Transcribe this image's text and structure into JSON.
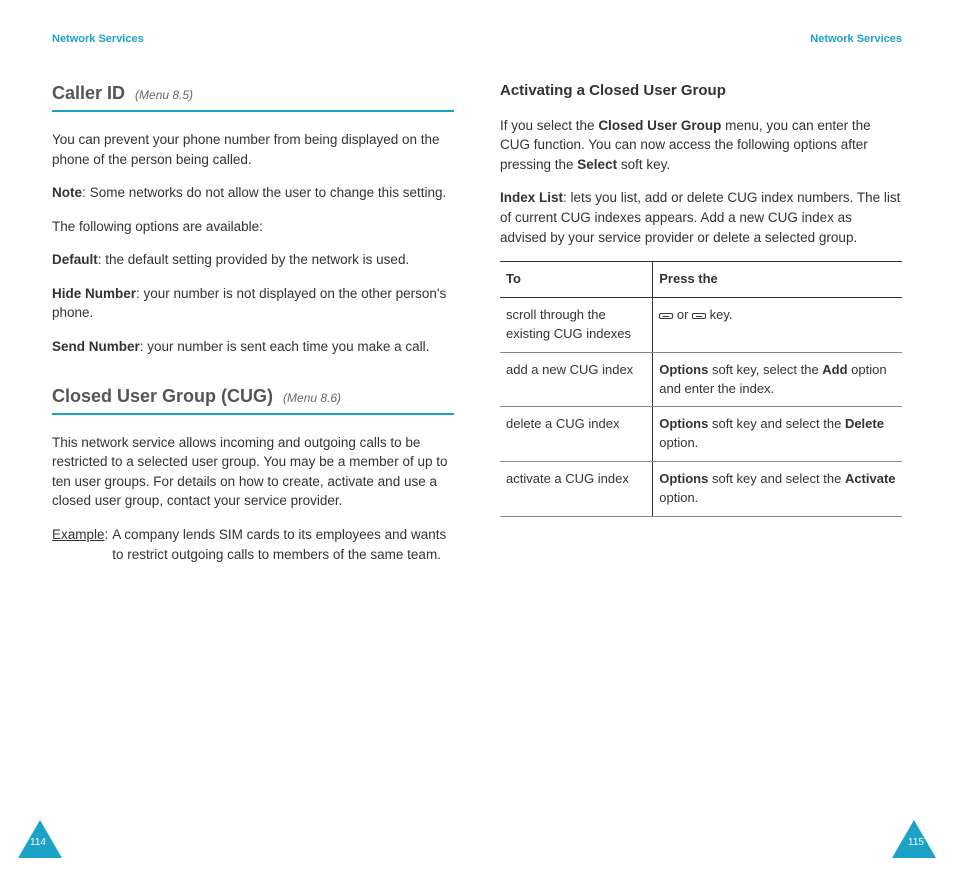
{
  "header": {
    "left": "Network Services",
    "right": "Network Services"
  },
  "left": {
    "s1_title": "Caller ID",
    "s1_menu": "(Menu 8.5)",
    "s1_p1": "You can prevent your phone number from being displayed on the phone of the person being called.",
    "s1_note_label": "Note",
    "s1_note_text": "Some networks do not allow the user to change this setting.",
    "s1_p2": "The following options are available:",
    "s1_o1_l": "Default",
    "s1_o1_t": ": the default setting provided by the network is used.",
    "s1_o2_l": "Hide Number",
    "s1_o2_t": ": your number is not displayed on the other person's phone.",
    "s1_o3_l": "Send Number",
    "s1_o3_t": ": your number is sent each time you make a call.",
    "s2_title": "Closed User Group (CUG)",
    "s2_menu": "(Menu 8.6)",
    "s2_p1": "This network service allows incoming and outgoing calls to be restricted to a selected user group. You may be a member of up to ten user groups. For details on how to create, activate and use a closed user group, contact your service provider.",
    "s2_ex_label": "Example",
    "s2_ex_text": "A company lends SIM cards to its employees and wants to restrict outgoing calls to members of the same team."
  },
  "right": {
    "sub": "Activating a Closed User Group",
    "p1a": "If you select the ",
    "p1b": "Closed User Group",
    "p1c": " menu, you can enter the CUG function. You can now access the following options after pressing the ",
    "p1d": "Select",
    "p1e": " soft key.",
    "p2a": "Index List",
    "p2b": ": lets you list, add or delete CUG index numbers. The list of current CUG indexes appears. Add a new CUG index as advised by your service provider or delete a selected group.",
    "th1": "To",
    "th2": "Press the",
    "r1c1": "scroll through the existing CUG indexes",
    "r1_mid": " or ",
    "r1_end": " key.",
    "r2c1": "add a new CUG index",
    "r2a": "Options",
    "r2b": " soft key, select the ",
    "r2c": "Add",
    "r2d": " option and enter the index.",
    "r3c1": "delete a CUG index",
    "r3a": "Options",
    "r3b": " soft key and select the ",
    "r3c": "Delete",
    "r3d": " option.",
    "r4c1": "activate a CUG index",
    "r4a": "Options",
    "r4b": " soft key and select the ",
    "r4c": "Activate",
    "r4d": " option."
  },
  "pages": {
    "left": "114",
    "right": "115"
  }
}
